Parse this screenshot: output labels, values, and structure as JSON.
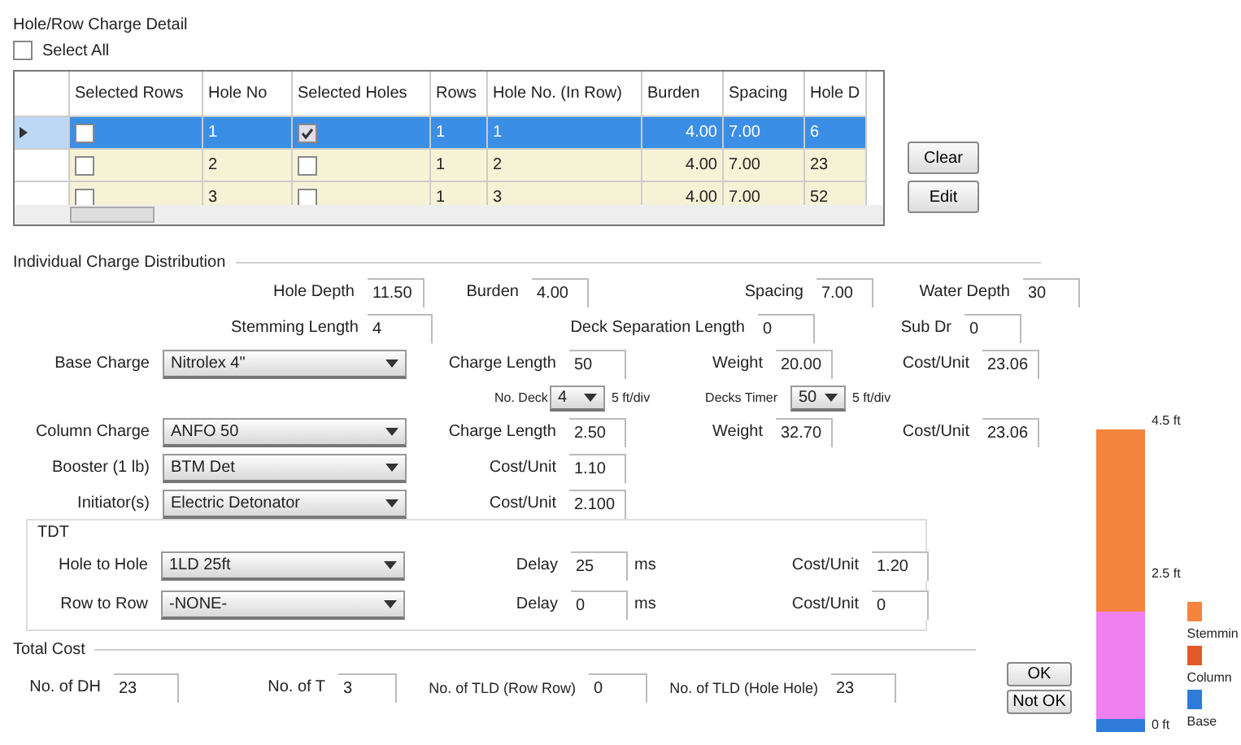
{
  "detail": {
    "title": "Hole/Row Charge Detail",
    "select_all": {
      "label": "Select All",
      "checked": false
    },
    "table": {
      "columns": [
        "Selected Rows",
        "Hole No",
        "Selected Holes",
        "Rows",
        "Hole No. (In Row)",
        "Burden",
        "Spacing",
        "Hole D"
      ],
      "rows": [
        {
          "selected": true,
          "row_checked": false,
          "hole_no": "1",
          "hole_checked": true,
          "rows": "1",
          "hole_in_row": "1",
          "burden": "4.00",
          "spacing": "7.00",
          "column_8": "6"
        },
        {
          "selected": false,
          "row_checked": false,
          "hole_no": "2",
          "hole_checked": false,
          "rows": "1",
          "hole_in_row": "2",
          "burden": "4.00",
          "spacing": "7.00",
          "column_8": "23"
        },
        {
          "selected": false,
          "row_checked": false,
          "hole_no": "3",
          "hole_checked": false,
          "rows": "1",
          "hole_in_row": "3",
          "burden": "4.00",
          "spacing": "7.00",
          "column_8": "52"
        }
      ]
    },
    "buttons": [
      "Clear",
      "Edit"
    ]
  },
  "distribution": {
    "title": "Individual Charge Distribution",
    "hole_depth": {
      "label": "Hole Depth",
      "value": "11.50"
    },
    "burden": {
      "label": "Burden",
      "value": "4.00"
    },
    "spacing": {
      "label": "Spacing",
      "value": "7.00"
    },
    "water_depth": {
      "label": "Water Depth",
      "value": "30"
    },
    "stemming_length": {
      "label": "Stemming Length",
      "value": "4"
    },
    "deck_separation": {
      "label": "Deck Separation Length",
      "value": "0"
    },
    "sub_drill": {
      "label": "Sub Dr",
      "value": "0"
    },
    "base_charge": {
      "label": "Base Charge",
      "value": "Nitrolex 4\"",
      "length_label": "Charge Length",
      "length": "50",
      "weight_label": "Weight",
      "weight": "20.00",
      "cost_label": "Cost/Unit",
      "cost": "23.06"
    },
    "decks": {
      "label": "No. Deck",
      "value": "4",
      "unit": "5 ft/div",
      "timer_label": "Decks Timer",
      "timer": "50",
      "timer_unit": "5 ft/div"
    },
    "column_charge": {
      "label": "Column Charge",
      "value": "ANFO 50",
      "length_label": "Charge Length",
      "length": "2.50",
      "weight_label": "Weight",
      "weight": "32.70",
      "cost_label": "Cost/Unit",
      "cost": "23.06"
    },
    "booster": {
      "label": "Booster (1 lb)",
      "value": "BTM Det",
      "cost_label": "Cost/Unit",
      "cost": "1.10"
    },
    "initiator": {
      "label": "Initiator(s)",
      "value": "Electric Detonator",
      "cost_label": "Cost/Unit",
      "cost": "2.100"
    },
    "tdt": {
      "title": "TDT",
      "rows": [
        {
          "label": "Hole to Hole",
          "value": "1LD 25ft",
          "delay_label": "Delay",
          "delay": "25",
          "unit": "ms",
          "cost_label": "Cost/Unit",
          "cost": "1.20"
        },
        {
          "label": "Row to Row",
          "value": "-NONE-",
          "delay_label": "Delay",
          "delay": "0",
          "unit": "ms",
          "cost_label": "Cost/Unit",
          "cost": "0"
        }
      ]
    }
  },
  "total_cost": {
    "title": "Total Cost",
    "fields": [
      {
        "label": "No. of DH",
        "value": "23"
      },
      {
        "label": "No. of T",
        "value": "3"
      },
      {
        "label": "No. of TLD (Row Row)",
        "value": "0"
      },
      {
        "label": "No. of TLD (Hole Hole)",
        "value": "23"
      }
    ],
    "buttons": [
      "OK",
      "Not OK"
    ]
  },
  "depth_bar": {
    "marks": [
      "4.5 ft",
      "2.5 ft",
      "0 ft"
    ],
    "segments": [
      {
        "color": "#f4843e"
      },
      {
        "color": "#f07ff0"
      },
      {
        "color": "#2f7bd8"
      }
    ],
    "legend": [
      {
        "label": "Stemmin",
        "color": "#f4843e"
      },
      {
        "label": "Column",
        "color": "#e05a28"
      },
      {
        "label": "Base",
        "color": "#2f7bd8"
      }
    ]
  }
}
